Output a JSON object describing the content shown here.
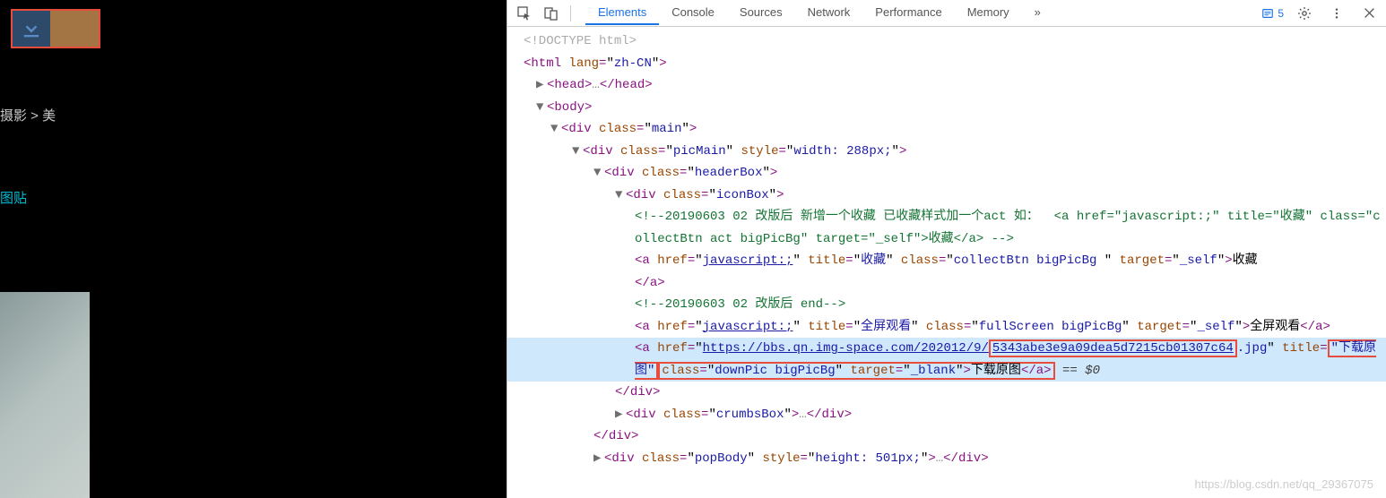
{
  "left": {
    "breadcrumb": "摄影  >  美",
    "link": "图贴"
  },
  "toolbar": {
    "tabs": [
      "Elements",
      "Console",
      "Sources",
      "Network",
      "Performance",
      "Memory"
    ],
    "active_tab": 0,
    "issues_count": "5"
  },
  "dom": {
    "doctype": "<!DOCTYPE html>",
    "html_open": {
      "tag": "html",
      "attrs": [
        [
          "lang",
          "zh-CN"
        ]
      ]
    },
    "head": {
      "open": "head",
      "dots": "…",
      "close": "head"
    },
    "body": {
      "tag": "body"
    },
    "main": {
      "tag": "div",
      "attrs": [
        [
          "class",
          "main"
        ]
      ]
    },
    "picMain": {
      "tag": "div",
      "attrs": [
        [
          "class",
          "picMain"
        ],
        [
          "style",
          "width: 288px;"
        ]
      ]
    },
    "headerBox": {
      "tag": "div",
      "attrs": [
        [
          "class",
          "headerBox"
        ]
      ]
    },
    "iconBox": {
      "tag": "div",
      "attrs": [
        [
          "class",
          "iconBox"
        ]
      ]
    },
    "comment1_a": "<!--20190603 02 改版后 新增一个收藏 已收藏样式加一个act 如： ",
    "comment1_b_pre": "<a href=\"javascript:;\"",
    "comment1_c": "title=\"收藏\" class=\"collectBtn act bigPicBg\" target=\"_self\">收藏</a> -->",
    "a_collect": {
      "tag": "a",
      "attrs": [
        [
          "href",
          "javascript:;"
        ],
        [
          "title",
          "收藏"
        ],
        [
          "class",
          "collectBtn bigPicBg "
        ],
        [
          "target",
          "_self"
        ]
      ],
      "text": "收藏"
    },
    "a_close": "</a>",
    "comment2": "<!--20190603 02 改版后 end-->",
    "a_fullscreen": {
      "tag": "a",
      "attrs": [
        [
          "href",
          "javascript:;"
        ],
        [
          "title",
          "全屏观看"
        ],
        [
          "class",
          "fullScreen bigPicBg"
        ],
        [
          "target",
          "_self"
        ]
      ],
      "text": "全屏观看"
    },
    "a_down_url_a": "https://bbs.qn.img-space.com/202012/9/",
    "a_down_url_b": "5343abe3e9a09dea5d7215cb01307c64",
    "a_down_url_c": ".jpg",
    "a_down_title": "\"下载原图\"",
    "a_down_rest_class": "downPic bigPicBg",
    "a_down_rest_target": "_blank",
    "a_down_text": "下载原图",
    "a_close2": "</a>",
    "eqdollar": " == $0",
    "div_close": "</div>",
    "crumbsBox": {
      "tag": "div",
      "attrs": [
        [
          "class",
          "crumbsBox"
        ]
      ],
      "dots": "…"
    },
    "popBody": {
      "tag": "div",
      "attrs": [
        [
          "class",
          "popBody"
        ],
        [
          "style",
          "height: 501px;"
        ]
      ],
      "dots": "…"
    }
  },
  "watermark": "https://blog.csdn.net/qq_29367075"
}
